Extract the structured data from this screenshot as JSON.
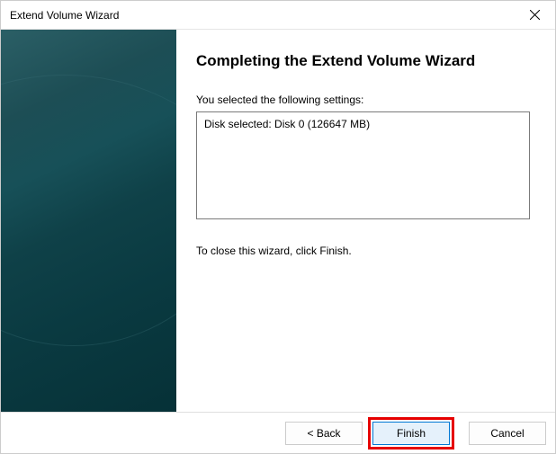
{
  "titlebar": {
    "title": "Extend Volume Wizard"
  },
  "main": {
    "heading": "Completing the Extend Volume Wizard",
    "settings_label": "You selected the following settings:",
    "settings_content": "Disk selected: Disk 0 (126647 MB)",
    "instruction": "To close this wizard, click Finish."
  },
  "buttons": {
    "back": "< Back",
    "finish": "Finish",
    "cancel": "Cancel"
  }
}
